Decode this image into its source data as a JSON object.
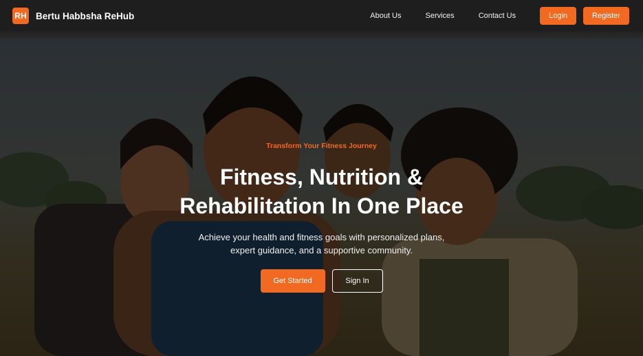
{
  "brand": {
    "logo_text": "RH",
    "name": "Bertu Habbsha ReHub"
  },
  "nav": {
    "links": [
      "About Us",
      "Services",
      "Contact Us"
    ],
    "login_label": "Login",
    "register_label": "Register"
  },
  "hero": {
    "eyebrow": "Transform Your Fitness Journey",
    "headline_line1": "Fitness, Nutrition &",
    "headline_line2": "Rehabilitation In One Place",
    "subtext_line1": "Achieve your health and fitness goals with personalized plans,",
    "subtext_line2": "expert guidance, and a supportive community.",
    "primary_cta": "Get Started",
    "secondary_cta": "Sign In"
  },
  "colors": {
    "accent": "#f26a21",
    "navbar": "#1e1e1e"
  }
}
